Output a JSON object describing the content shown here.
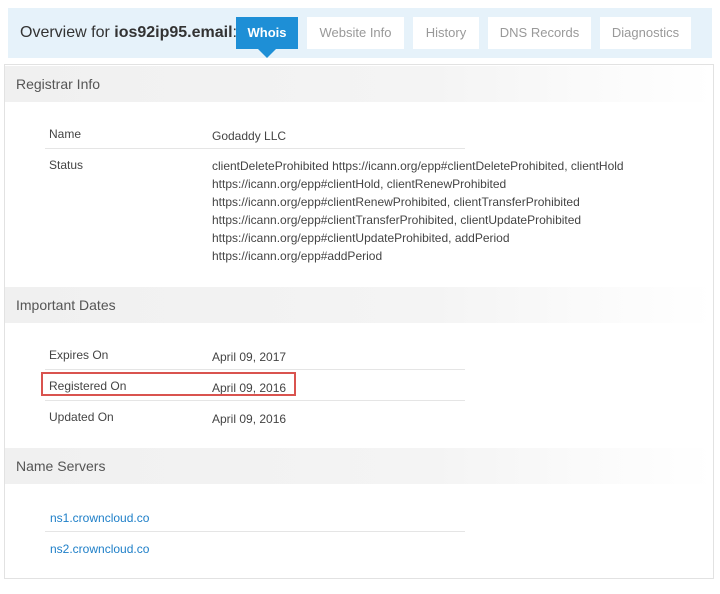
{
  "header": {
    "overview_prefix": "Overview for ",
    "domain": "ios92ip95.email",
    "suffix": ":",
    "tabs": [
      {
        "label": "Whois",
        "active": true
      },
      {
        "label": "Website Info",
        "active": false
      },
      {
        "label": "History",
        "active": false
      },
      {
        "label": "DNS Records",
        "active": false
      },
      {
        "label": "Diagnostics",
        "active": false
      }
    ]
  },
  "registrar": {
    "title": "Registrar Info",
    "name_label": "Name",
    "name_value": "Godaddy LLC",
    "status_label": "Status",
    "status_lines": [
      "clientDeleteProhibited https://icann.org/epp#clientDeleteProhibited, clientHold",
      "https://icann.org/epp#clientHold, clientRenewProhibited",
      "https://icann.org/epp#clientRenewProhibited, clientTransferProhibited",
      "https://icann.org/epp#clientTransferProhibited, clientUpdateProhibited",
      "https://icann.org/epp#clientUpdateProhibited, addPeriod",
      "https://icann.org/epp#addPeriod"
    ]
  },
  "dates": {
    "title": "Important Dates",
    "expires_label": "Expires On",
    "expires_value": "April 09, 2017",
    "registered_label": "Registered On",
    "registered_value": "April 09, 2016",
    "updated_label": "Updated On",
    "updated_value": "April 09, 2016"
  },
  "nameservers": {
    "title": "Name Servers",
    "items": [
      "ns1.crowncloud.co",
      "ns2.crowncloud.co"
    ]
  },
  "colors": {
    "accent": "#1e8fd6",
    "header_bg": "#e6f2fa",
    "highlight": "#d9534f",
    "link": "#1e7fc8"
  }
}
